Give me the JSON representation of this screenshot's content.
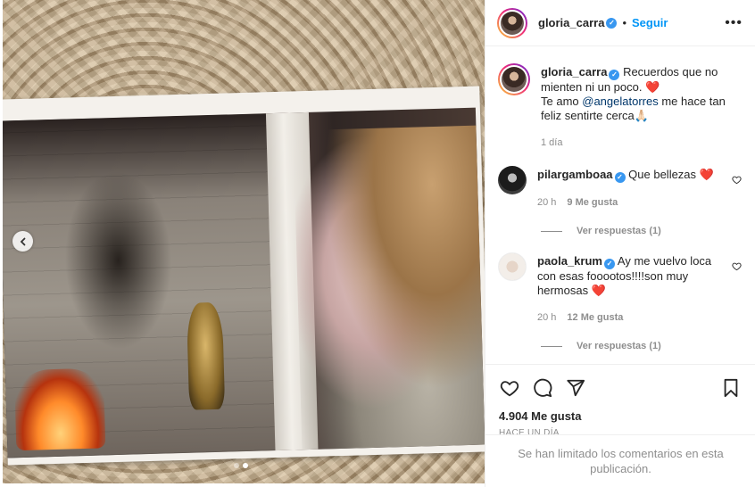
{
  "post_author": {
    "username": "gloria_carra",
    "verified": true,
    "follow_label": "Seguir",
    "separator": "•"
  },
  "media": {
    "slide_count": 2,
    "active_slide": 2
  },
  "caption": {
    "username": "gloria_carra",
    "line1": "Recuerdos que no mienten ni un poco.",
    "heart": "❤️",
    "line2_prefix": "Te amo ",
    "mention": "@angelatorres",
    "line2_suffix": " me hace tan feliz sentirte cerca",
    "emoji_end": "🙏🏻",
    "time": "1 día"
  },
  "comments": [
    {
      "username": "pilargamboaa",
      "text": "Que bellezas",
      "heart": "❤️",
      "time": "20 h",
      "likes": "9 Me gusta",
      "replies": "Ver respuestas (1)"
    },
    {
      "username": "paola_krum",
      "text": "Ay me vuelvo loca con esas fooootos!!!!son muy hermosas",
      "heart": "❤️",
      "time": "20 h",
      "likes": "12 Me gusta",
      "replies": "Ver respuestas (1)"
    }
  ],
  "engagement": {
    "likes": "4.904 Me gusta",
    "date": "HACE UN DÍA"
  },
  "footer": {
    "limited_notice": "Se han limitado los comentarios en esta publicación."
  },
  "colors": {
    "accent": "#0095f6",
    "verified": "#3897f0",
    "heart": "#ed4956",
    "muted": "#8e8e8e"
  },
  "icons": [
    "chevron-left-icon",
    "more-options-icon",
    "heart-icon",
    "comment-icon",
    "share-icon",
    "bookmark-icon",
    "verified-icon"
  ]
}
